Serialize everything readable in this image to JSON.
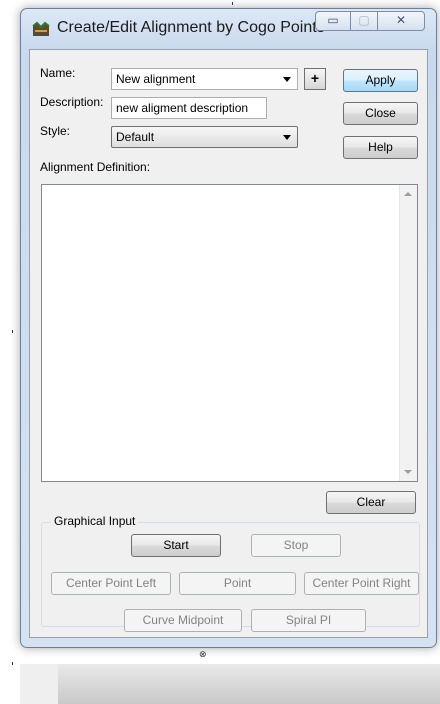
{
  "window": {
    "title": "Create/Edit Alignment by Cogo Points",
    "minimize_glyph": "▭",
    "maximize_glyph": "▢",
    "close_glyph": "✕"
  },
  "form": {
    "name_label": "Name:",
    "name_value": "New alignment",
    "description_label": "Description:",
    "description_value": "new aligment description",
    "style_label": "Style:",
    "style_value": "Default",
    "pick_glyph": "+",
    "definition_label": "Alignment Definition:"
  },
  "buttons": {
    "apply": "Apply",
    "close": "Close",
    "help": "Help",
    "clear": "Clear"
  },
  "graphical_input": {
    "title": "Graphical Input",
    "start": "Start",
    "stop": "Stop",
    "center_point_left": "Center Point Left",
    "point": "Point",
    "center_point_right": "Center Point Right",
    "curve_midpoint": "Curve Midpoint",
    "spiral_pi": "Spiral PI"
  },
  "icons": {
    "app": "alignment-app-icon",
    "pick": "pick-point-icon",
    "combo": "chevron-down-icon",
    "size_grip": "size-grip-icon"
  },
  "colors": {
    "titlebar": "#c9daee",
    "client_bg": "#f0f0f0",
    "primary_border": "#3c7fb1",
    "disabled_text": "#838383"
  }
}
